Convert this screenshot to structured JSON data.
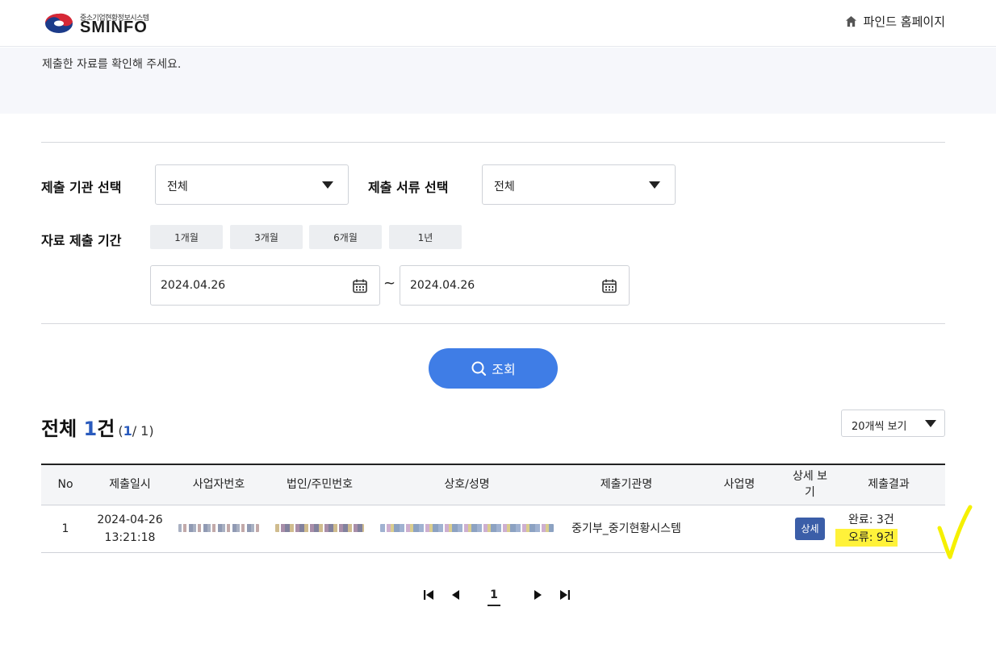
{
  "header": {
    "logo_subtitle": "중소기업현황정보시스템",
    "logo_title": "SMINFO",
    "home_link": "파인드 홈페이지"
  },
  "notice": {
    "text": "제출한 자료를 확인해 주세요."
  },
  "filters": {
    "agency_label": "제출 기관 선택",
    "agency_value": "전체",
    "doc_label": "제출 서류 선택",
    "doc_value": "전체",
    "period_label": "자료 제출 기간",
    "period_buttons": [
      "1개월",
      "3개월",
      "6개월",
      "1년"
    ],
    "start_date": "2024.04.26",
    "date_separator": "~",
    "end_date": "2024.04.26"
  },
  "search_button": "조회",
  "summary": {
    "prefix": "전체 ",
    "count": "1",
    "suffix": "건",
    "page_open": "(",
    "current_page": "1",
    "page_total": "/ 1)"
  },
  "page_size": "20개씩 보기",
  "table": {
    "headers": [
      "No",
      "제출일시",
      "사업자번호",
      "법인/주민번호",
      "상호/성명",
      "제출기관명",
      "사업명",
      "상세 보기",
      "제출결과"
    ],
    "rows": [
      {
        "no": "1",
        "date": "2024-04-26",
        "time": "13:21:18",
        "agency": "중기부_중기현황시스템",
        "project": "",
        "detail": "상세",
        "result_done": "완료: 3건",
        "result_error": "오류: 9건"
      }
    ]
  },
  "pagination": {
    "current": "1"
  },
  "colors": {
    "primary": "#3f7de6",
    "accent_navy": "#2a5bbd",
    "detail_badge": "#3b5ea8",
    "highlight": "#fff23a",
    "notice_bg": "#f6f7fb"
  },
  "icons": [
    "home-icon",
    "caret-down-icon",
    "calendar-icon",
    "search-icon",
    "first-page-icon",
    "prev-page-icon",
    "next-page-icon",
    "last-page-icon"
  ]
}
